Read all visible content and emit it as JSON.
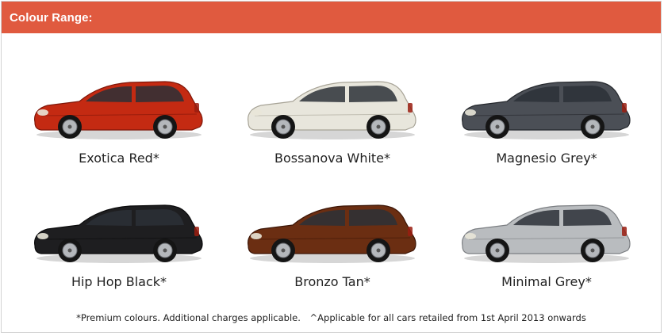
{
  "header": {
    "title": "Colour Range:"
  },
  "colours": [
    {
      "name": "Exotica Red*",
      "body": "#c42a12",
      "shade": "#7e1608"
    },
    {
      "name": "Bossanova White*",
      "body": "#e8e6dc",
      "shade": "#a7a396"
    },
    {
      "name": "Magnesio Grey*",
      "body": "#4b4f56",
      "shade": "#24272c"
    },
    {
      "name": "Hip Hop Black*",
      "body": "#1e1e20",
      "shade": "#0a0a0b"
    },
    {
      "name": "Bronzo Tan*",
      "body": "#6b2e12",
      "shade": "#3c1607"
    },
    {
      "name": "Minimal Grey*",
      "body": "#b9bcbf",
      "shade": "#7b7e82"
    }
  ],
  "footnote": {
    "premium": "*Premium colours. Additional charges applicable.",
    "applicable": "^Applicable for all cars retailed from 1st April 2013 onwards"
  }
}
